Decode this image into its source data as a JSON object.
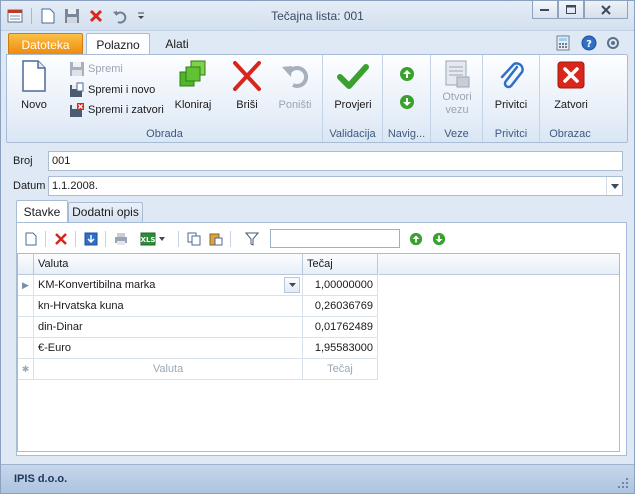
{
  "window": {
    "title": "Tečajna lista: 001"
  },
  "ribbon_tabs": {
    "app": "Datoteka",
    "active": "Polazno",
    "other": "Alati"
  },
  "ribbon": {
    "groups": {
      "obrada": "Obrada",
      "validacija": "Validacija",
      "navigacija": "Navig...",
      "veze": "Veze",
      "privitci": "Privitci",
      "obrazac": "Obrazac"
    },
    "buttons": {
      "novo": "Novo",
      "spremi": "Spremi",
      "spremi_i_novo": "Spremi i novo",
      "spremi_i_zatvori": "Spremi i zatvori",
      "kloniraj": "Kloniraj",
      "brisi": "Briši",
      "ponisti": "Poništi",
      "provjeri": "Provjeri",
      "otvori_vezu_1": "Otvori",
      "otvori_vezu_2": "vezu",
      "privitci": "Privitci",
      "zatvori": "Zatvori"
    }
  },
  "form": {
    "broj_label": "Broj",
    "broj_value": "001",
    "datum_label": "Datum",
    "datum_value": "1.1.2008."
  },
  "inner_tabs": {
    "stavke": "Stavke",
    "dodatni_opis": "Dodatni opis"
  },
  "grid": {
    "search_value": "",
    "columns": [
      "Valuta",
      "Tečaj"
    ],
    "rows": [
      {
        "valuta": "KM-Konvertibilna marka",
        "tecaj": "1,00000000"
      },
      {
        "valuta": "kn-Hrvatska kuna",
        "tecaj": "0,26036769"
      },
      {
        "valuta": "din-Dinar",
        "tecaj": "0,01762489"
      },
      {
        "valuta": "€-Euro",
        "tecaj": "1,95583000"
      }
    ],
    "new_row": {
      "valuta": "Valuta",
      "tecaj": "Tečaj"
    }
  },
  "status": {
    "company": "IPIS d.o.o."
  },
  "colors": {
    "accent_orange": "#f08a0d",
    "ribbon_label_blue": "#3e5a80",
    "close_red": "#d9261c",
    "check_green": "#3aa12f"
  }
}
